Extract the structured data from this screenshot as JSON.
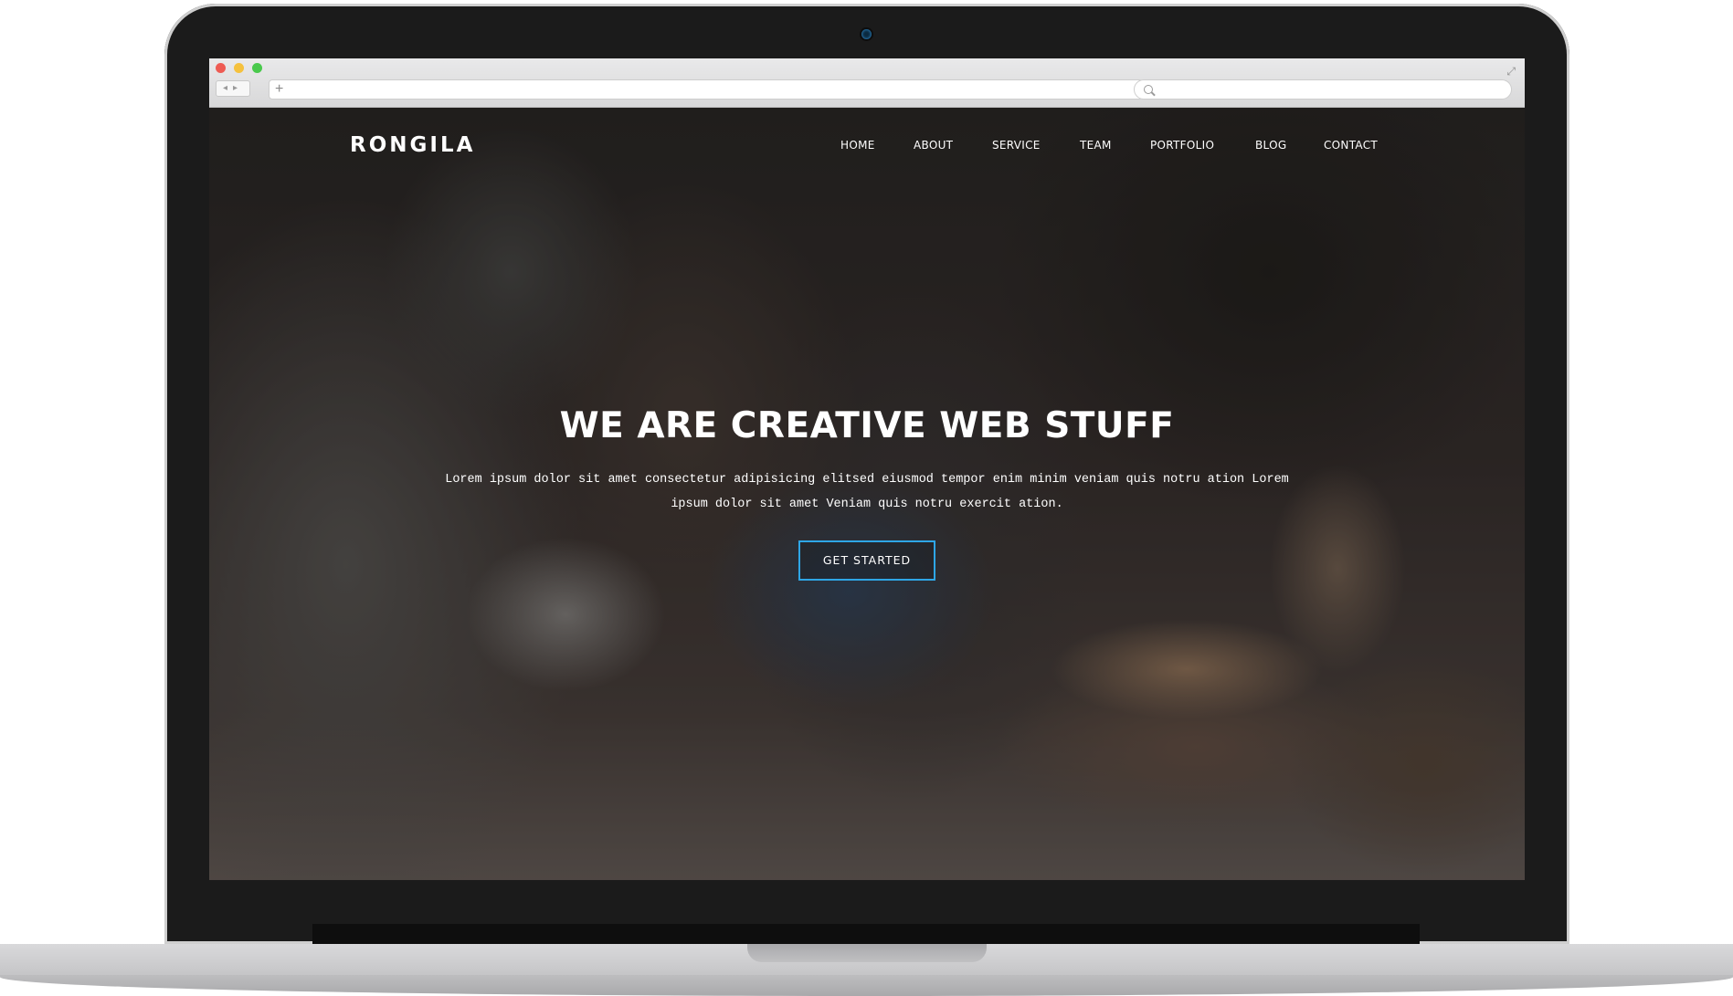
{
  "site": {
    "brand": "RONGILA",
    "nav": [
      {
        "label": "HOME"
      },
      {
        "label": "ABOUT"
      },
      {
        "label": "SERVICE"
      },
      {
        "label": "TEAM"
      },
      {
        "label": "PORTFOLIO"
      },
      {
        "label": "BLOG"
      },
      {
        "label": "CONTACT"
      }
    ]
  },
  "hero": {
    "headline": "WE ARE CREATIVE WEB STUFF",
    "text": "Lorem ipsum dolor sit amet consectetur adipisicing elitsed eiusmod tempor enim minim veniam quis notru ation Lorem ipsum dolor sit amet Veniam quis notru exercit ation.",
    "button": "GET STARTED"
  },
  "colors": {
    "accent": "#2ea6e6",
    "laptop_bezel": "#1b1b1b"
  },
  "icons": {
    "browser_controls": [
      "close-dot",
      "minimize-dot",
      "maximize-dot",
      "back-forward-arrows",
      "new-tab-plus",
      "search-icon",
      "fullscreen-icon"
    ]
  }
}
